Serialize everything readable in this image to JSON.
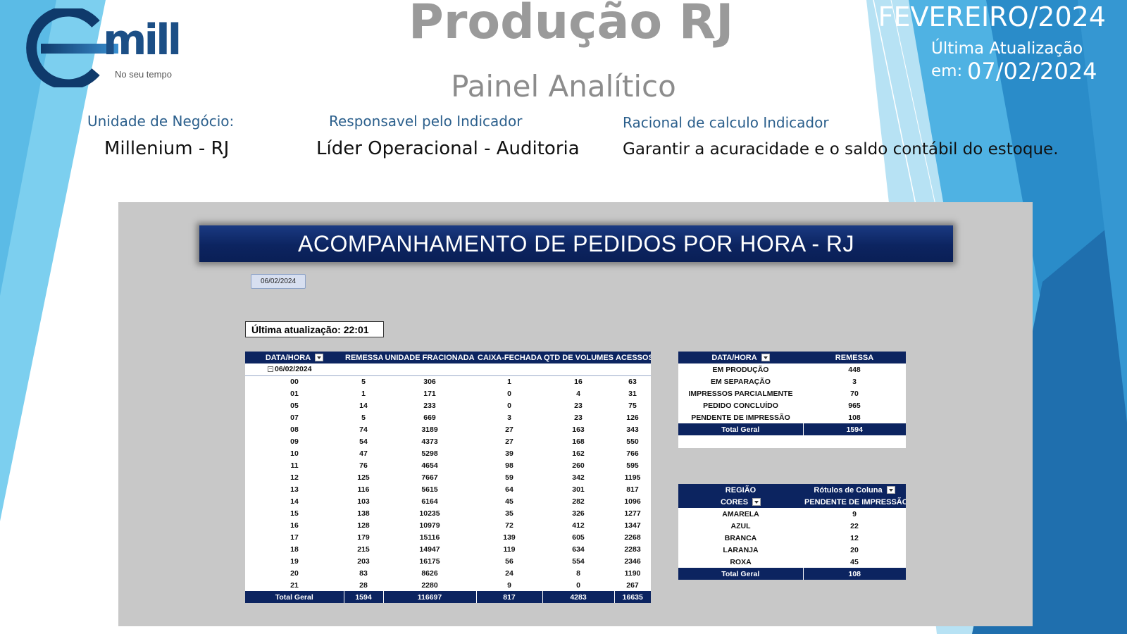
{
  "logo": {
    "text": "mill",
    "tagline": "No seu tempo"
  },
  "header": {
    "title": "Produção RJ",
    "subtitle": "Painel Analítico",
    "period": "FEVEREIRO/2024",
    "update_label": "Última Atualização",
    "update_em": "em:",
    "update_date": "07/02/2024"
  },
  "info": {
    "unit_label": "Unidade de Negócio:",
    "unit_value": "Millenium - RJ",
    "resp_label": "Responsavel pelo Indicador",
    "resp_value": "Líder Operacional - Auditoria",
    "rational_label": "Racional de calculo Indicador",
    "rational_value": "Garantir a acuracidade e o saldo contábil do estoque."
  },
  "panel": {
    "banner": "ACOMPANHAMENTO DE PEDIDOS POR HORA - RJ",
    "slicer_date": "06/02/2024",
    "last_update": "Última atualização:  22:01"
  },
  "hourly_table": {
    "headers": [
      "DATA/HORA",
      "REMESSA",
      "UNIDADE FRACIONADA",
      "CAIXA-FECHADA",
      "QTD DE VOLUMES",
      "ACESSOS"
    ],
    "group": "06/02/2024",
    "rows": [
      [
        "00",
        "5",
        "306",
        "1",
        "16",
        "63"
      ],
      [
        "01",
        "1",
        "171",
        "0",
        "4",
        "31"
      ],
      [
        "05",
        "14",
        "233",
        "0",
        "23",
        "75"
      ],
      [
        "07",
        "5",
        "669",
        "3",
        "23",
        "126"
      ],
      [
        "08",
        "74",
        "3189",
        "27",
        "163",
        "343"
      ],
      [
        "09",
        "54",
        "4373",
        "27",
        "168",
        "550"
      ],
      [
        "10",
        "47",
        "5298",
        "39",
        "162",
        "766"
      ],
      [
        "11",
        "76",
        "4654",
        "98",
        "260",
        "595"
      ],
      [
        "12",
        "125",
        "7667",
        "59",
        "342",
        "1195"
      ],
      [
        "13",
        "116",
        "5615",
        "64",
        "301",
        "817"
      ],
      [
        "14",
        "103",
        "6164",
        "45",
        "282",
        "1096"
      ],
      [
        "15",
        "138",
        "10235",
        "35",
        "326",
        "1277"
      ],
      [
        "16",
        "128",
        "10979",
        "72",
        "412",
        "1347"
      ],
      [
        "17",
        "179",
        "15116",
        "139",
        "605",
        "2268"
      ],
      [
        "18",
        "215",
        "14947",
        "119",
        "634",
        "2283"
      ],
      [
        "19",
        "203",
        "16175",
        "56",
        "554",
        "2346"
      ],
      [
        "20",
        "83",
        "8626",
        "24",
        "8",
        "1190"
      ],
      [
        "21",
        "28",
        "2280",
        "9",
        "0",
        "267"
      ]
    ],
    "total": [
      "Total Geral",
      "1594",
      "116697",
      "817",
      "4283",
      "16635"
    ]
  },
  "status_table": {
    "headers": [
      "DATA/HORA",
      "REMESSA"
    ],
    "rows": [
      [
        "EM PRODUÇÃO",
        "448"
      ],
      [
        "EM SEPARAÇÃO",
        "3"
      ],
      [
        "IMPRESSOS PARCIALMENTE",
        "70"
      ],
      [
        "PEDIDO CONCLUÍDO",
        "965"
      ],
      [
        "PENDENTE DE IMPRESSÃO",
        "108"
      ]
    ],
    "total": [
      "Total Geral",
      "1594"
    ]
  },
  "region_table": {
    "header_row1": [
      "REGIÃO",
      "Rótulos de Coluna"
    ],
    "header_row2": [
      "CORES",
      "PENDENTE DE IMPRESSÃO"
    ],
    "rows": [
      [
        "AMARELA",
        "9"
      ],
      [
        "AZUL",
        "22"
      ],
      [
        "BRANCA",
        "12"
      ],
      [
        "LARANJA",
        "20"
      ],
      [
        "ROXA",
        "45"
      ]
    ],
    "total": [
      "Total Geral",
      "108"
    ]
  },
  "colors": {
    "navy": "#0c2460",
    "panel_gray": "#c8c8c8",
    "label_blue": "#2b5f8c",
    "accent_light_blue": "#6fc6ee",
    "accent_dark_blue": "#1e73b0"
  }
}
